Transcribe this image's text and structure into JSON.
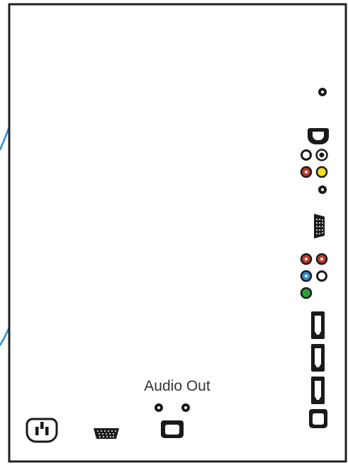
{
  "labels": {
    "audio_out": "Audio Out"
  },
  "colors": {
    "panel_border": "#222222",
    "cable": "#2d8fd5",
    "black": "#1a1a1a",
    "white": "#ffffff",
    "red": "#c0392b",
    "yellow": "#f2e11b",
    "blue": "#2d8fd5",
    "green": "#2e9d3a",
    "label": "#333333"
  },
  "connectors": {
    "right_column": [
      "headphone-jack",
      "s-video-port",
      "composite-audio-l-jack",
      "s-video-round-jack",
      "composite-audio-r-jack",
      "composite-video-jack",
      "mini-jack",
      "vga-port",
      "component-audio-r-jack",
      "component-audio-l-jack",
      "component-pb-jack",
      "component-pr-jack",
      "component-y-jack",
      "hdmi-port-1",
      "hdmi-port-2",
      "hdmi-port-3",
      "optical-port"
    ],
    "bottom_row": [
      "power-socket",
      "vga-port-bottom",
      "audio-out-jack-left",
      "audio-out-jack-right",
      "optical-audio-out-port"
    ]
  }
}
